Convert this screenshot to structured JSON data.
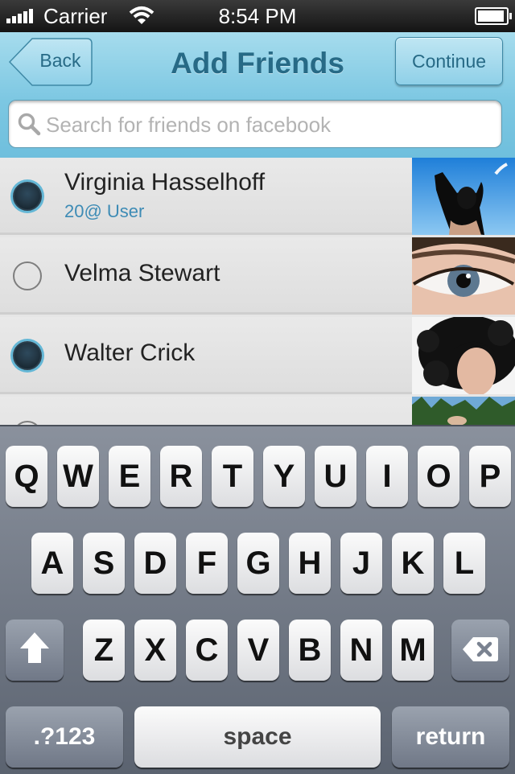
{
  "status_bar": {
    "carrier": "Carrier",
    "time": "8:54 PM"
  },
  "header": {
    "title": "Add Friends",
    "back_label": "Back",
    "continue_label": "Continue",
    "search_placeholder": "Search for friends on facebook"
  },
  "colors": {
    "accent": "#3d8bb5",
    "title": "#276a86",
    "header_bg": "#7cc7e2"
  },
  "friends": [
    {
      "name": "Virginia Hasselhoff",
      "subtitle": "20@ User",
      "selected": true,
      "photo": "person-arms-raised-sky-photo"
    },
    {
      "name": "Velma Stewart",
      "subtitle": "",
      "selected": false,
      "photo": "eye-closeup-photo"
    },
    {
      "name": "Walter Crick",
      "subtitle": "",
      "selected": true,
      "photo": "curly-hair-portrait-photo"
    },
    {
      "name": "",
      "subtitle": "",
      "selected": false,
      "photo": "trees-photo"
    }
  ],
  "keyboard": {
    "row1": [
      "Q",
      "W",
      "E",
      "R",
      "T",
      "Y",
      "U",
      "I",
      "O",
      "P"
    ],
    "row2": [
      "A",
      "S",
      "D",
      "F",
      "G",
      "H",
      "J",
      "K",
      "L"
    ],
    "row3": [
      "Z",
      "X",
      "C",
      "V",
      "B",
      "N",
      "M"
    ],
    "numbers_label": ".?123",
    "space_label": "space",
    "return_label": "return"
  }
}
